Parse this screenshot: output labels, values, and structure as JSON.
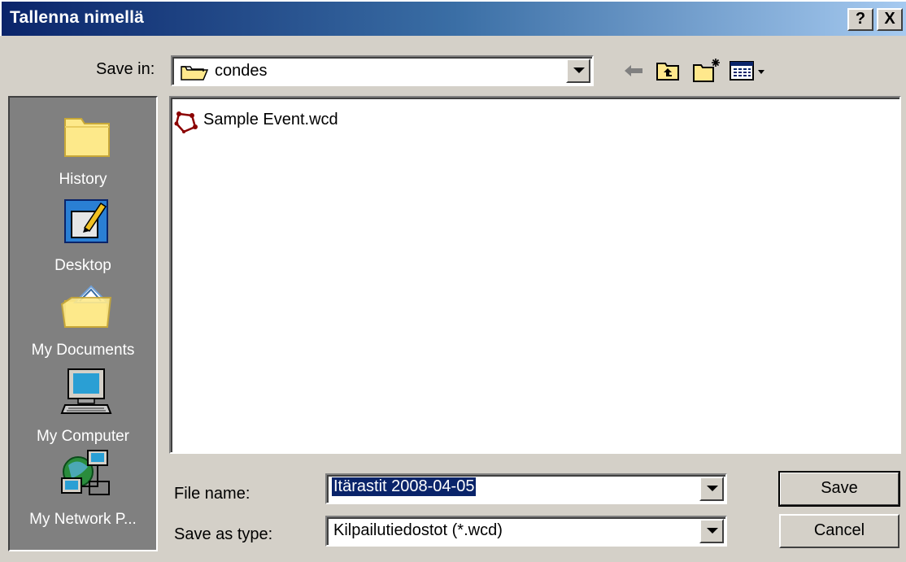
{
  "window": {
    "title": "Tallenna nimellä",
    "help_label": "?",
    "close_label": "X"
  },
  "save_in": {
    "label": "Save in:",
    "value": "condes"
  },
  "places": [
    {
      "label": "History",
      "icon": "folder-history-icon"
    },
    {
      "label": "Desktop",
      "icon": "desktop-icon"
    },
    {
      "label": "My Documents",
      "icon": "my-documents-icon"
    },
    {
      "label": "My Computer",
      "icon": "my-computer-icon"
    },
    {
      "label": "My Network P...",
      "icon": "network-places-icon"
    }
  ],
  "files": [
    {
      "name": "Sample Event.wcd",
      "icon": "course-file-icon"
    }
  ],
  "file_name": {
    "label": "File name:",
    "value": "Itärastit 2008-04-05"
  },
  "save_as_type": {
    "label": "Save as type:",
    "value": "Kilpailutiedostot (*.wcd)"
  },
  "buttons": {
    "save": "Save",
    "cancel": "Cancel"
  },
  "colors": {
    "titlebar_start": "#0a246a",
    "titlebar_end": "#a6caf0",
    "dialog_face": "#d4d0c8",
    "places_bg": "#808080",
    "selection": "#0a246a"
  }
}
